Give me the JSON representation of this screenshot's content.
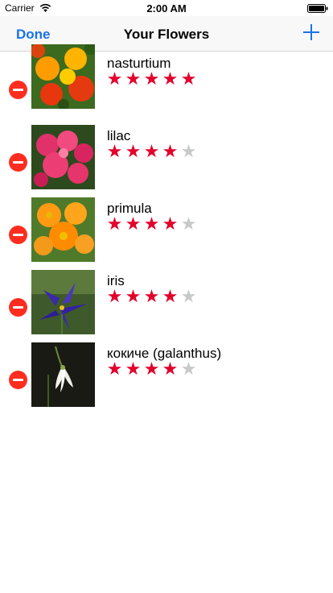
{
  "status_bar": {
    "carrier": "Carrier",
    "time": "2:00 AM"
  },
  "nav": {
    "done_label": "Done",
    "title": "Your Flowers",
    "add_icon": "plus-icon"
  },
  "accent_color": "#1a73e8",
  "delete_color": "#ff2d20",
  "star_color": "#e3002b",
  "flowers": [
    {
      "name": "nasturtium",
      "rating": 5,
      "max_rating": 5
    },
    {
      "name": "lilac",
      "rating": 4,
      "max_rating": 5
    },
    {
      "name": "primula",
      "rating": 4,
      "max_rating": 5
    },
    {
      "name": "iris",
      "rating": 4,
      "max_rating": 5
    },
    {
      "name": "кокиче (galanthus)",
      "rating": 4,
      "max_rating": 5
    }
  ]
}
